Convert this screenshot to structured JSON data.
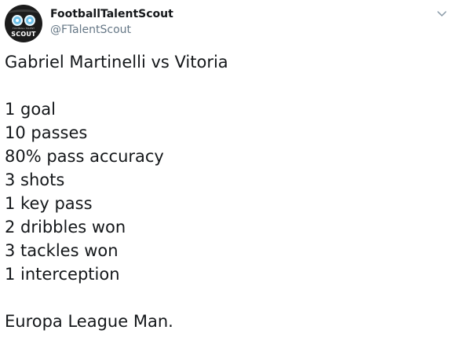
{
  "author": {
    "display_name": "FootballTalentScout",
    "handle": "@FTalentScout",
    "avatar_text": "SCOUT",
    "avatar_small_text": "FOOTBALL TALENT"
  },
  "tweet": {
    "title_line": "Gabriel Martinelli vs Vitoria",
    "stats": [
      "1 goal",
      "10 passes",
      "80% pass accuracy",
      "3 shots",
      "1 key pass",
      "2 dribbles won",
      "3 tackles won",
      "1 interception"
    ],
    "closing_line": "Europa League Man."
  },
  "icons": {
    "menu": "chevron-down-icon"
  },
  "colors": {
    "text_primary": "#14171a",
    "text_secondary": "#657786",
    "avatar_bg": "#1c1c1c",
    "avatar_eye": "#6ec1ea"
  }
}
